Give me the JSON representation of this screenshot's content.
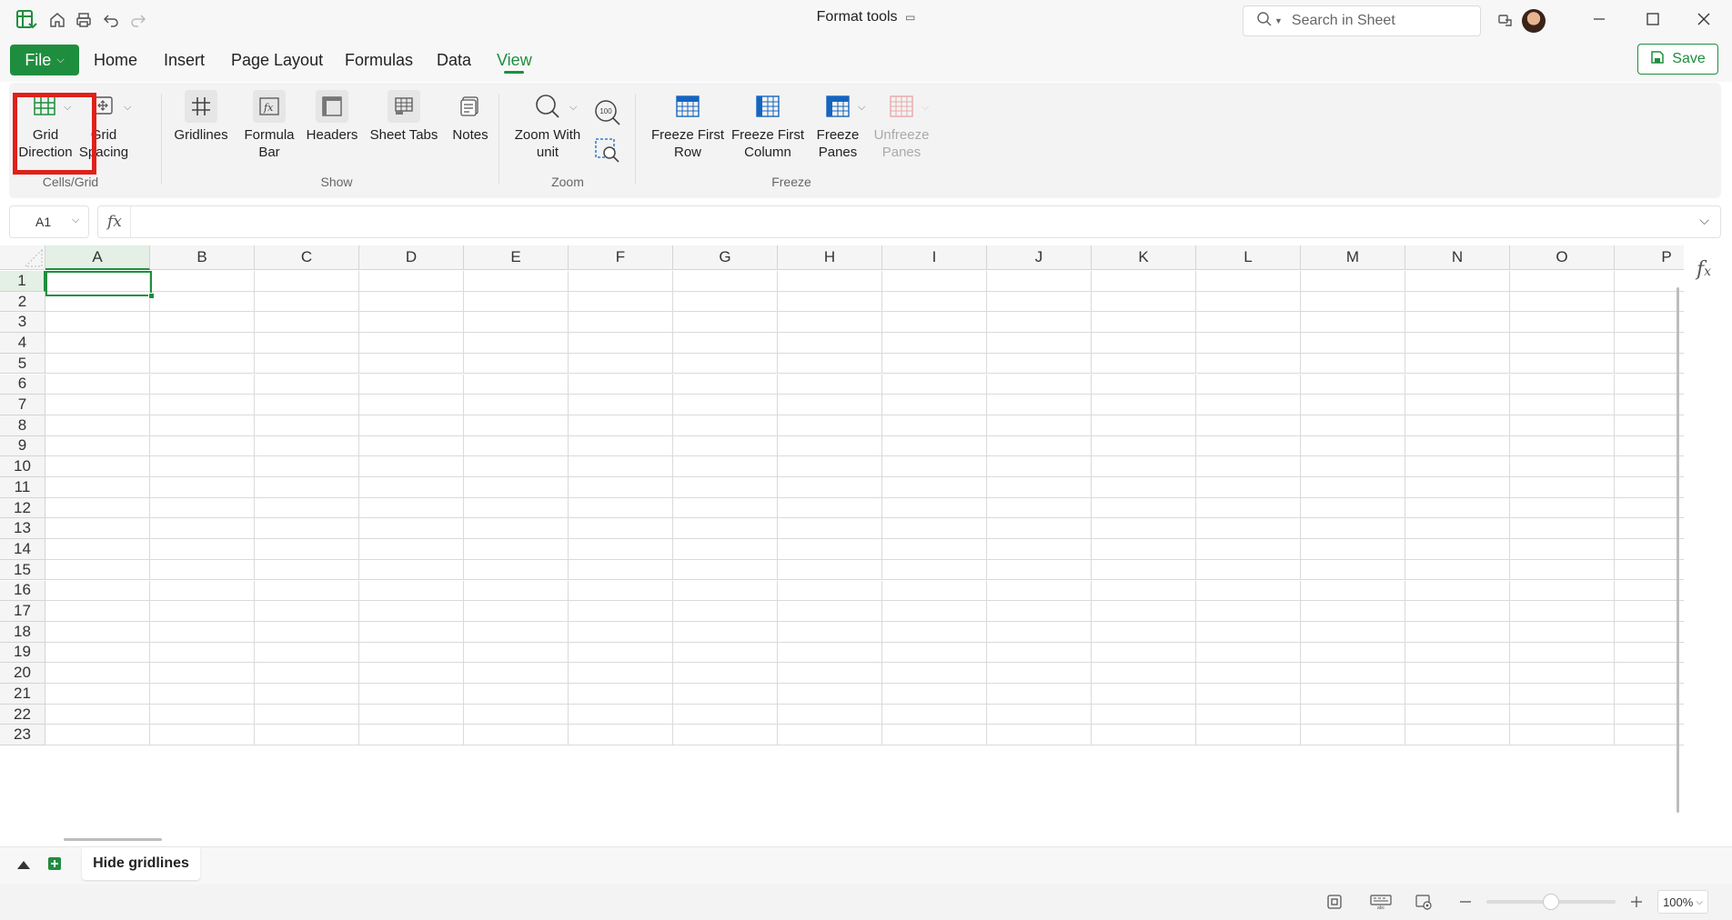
{
  "window": {
    "title": "Format tools",
    "search_placeholder": "Search in Sheet"
  },
  "menu": {
    "file_label": "File",
    "items": [
      "Home",
      "Insert",
      "Page Layout",
      "Formulas",
      "Data",
      "View"
    ],
    "active": "View",
    "save_label": "Save"
  },
  "ribbon": {
    "groups": {
      "cells_grid": "Cells/Grid",
      "show": "Show",
      "zoom": "Zoom",
      "freeze": "Freeze"
    },
    "buttons": {
      "grid_direction": [
        "Grid",
        "Direction"
      ],
      "grid_spacing": [
        "Grid",
        "Spacing"
      ],
      "gridlines": "Gridlines",
      "formula_bar": [
        "Formula",
        "Bar"
      ],
      "headers": "Headers",
      "sheet_tabs": "Sheet Tabs",
      "notes": "Notes",
      "zoom_with_unit": [
        "Zoom With",
        "unit"
      ],
      "freeze_first_row": [
        "Freeze First",
        "Row"
      ],
      "freeze_first_column": [
        "Freeze First",
        "Column"
      ],
      "freeze_panes": [
        "Freeze",
        "Panes"
      ],
      "unfreeze_panes": [
        "Unfreeze",
        "Panes"
      ]
    },
    "zoom_100_label": "100"
  },
  "formula_bar": {
    "cell_ref": "A1",
    "fx_label": "fx",
    "value": ""
  },
  "sheet": {
    "columns": [
      "A",
      "B",
      "C",
      "D",
      "E",
      "F",
      "G",
      "H",
      "I",
      "J",
      "K",
      "L",
      "M",
      "N",
      "O",
      "P"
    ],
    "rows": [
      "1",
      "2",
      "3",
      "4",
      "5",
      "6",
      "7",
      "8",
      "9",
      "10",
      "11",
      "12",
      "13",
      "14",
      "15",
      "16",
      "17",
      "18",
      "19",
      "20",
      "21",
      "22",
      "23"
    ],
    "selected_cell": "A1"
  },
  "sheet_tabs": {
    "tabs": [
      "Hide gridlines"
    ],
    "active": "Hide gridlines"
  },
  "status": {
    "zoom": "100%",
    "zoom_fraction": 0.5
  },
  "colors": {
    "accent": "#1e8e3e",
    "highlight": "#e0201a"
  }
}
